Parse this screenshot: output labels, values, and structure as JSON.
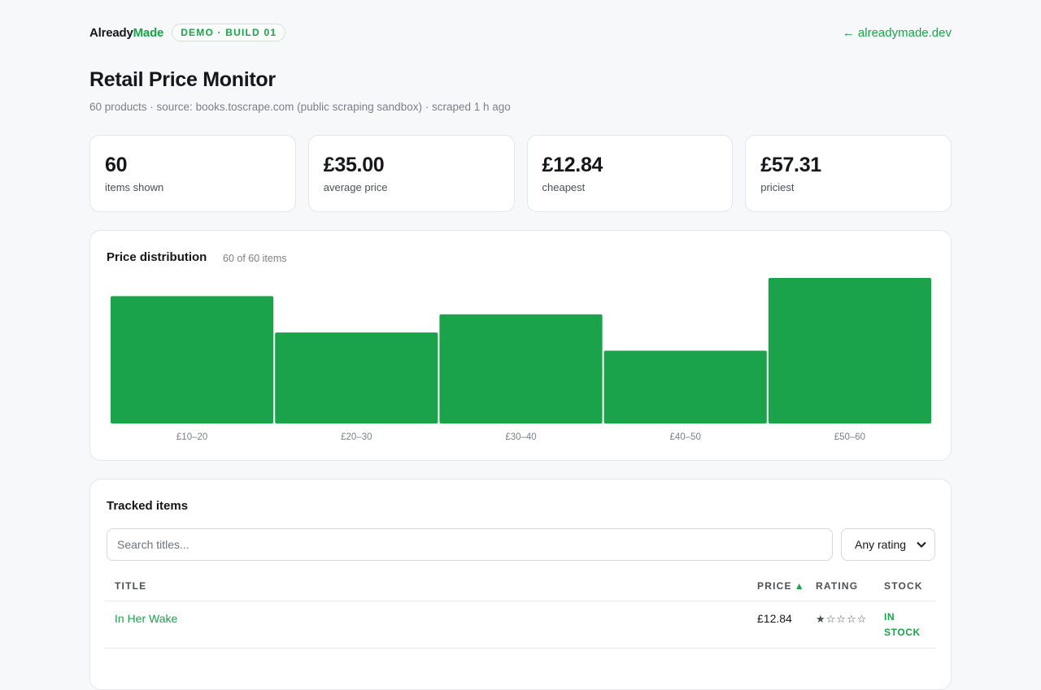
{
  "brand": {
    "name_part1": "Already",
    "name_part2": "Made",
    "badge": "DEMO · BUILD 01",
    "back_link": "← alreadymade.dev"
  },
  "page": {
    "title": "Retail Price Monitor",
    "subtitle": "60 products · source: books.toscrape.com (public scraping sandbox) · scraped 1 h ago"
  },
  "stats": [
    {
      "value": "60",
      "label": "items shown"
    },
    {
      "value": "£35.00",
      "label": "average price"
    },
    {
      "value": "£12.84",
      "label": "cheapest"
    },
    {
      "value": "£57.31",
      "label": "priciest"
    }
  ],
  "chart": {
    "title": "Price distribution",
    "count_label": "60 of 60 items"
  },
  "chart_data": {
    "type": "bar",
    "categories": [
      "£10–20",
      "£20–30",
      "£30–40",
      "£40–50",
      "£50–60"
    ],
    "values": [
      14,
      10,
      12,
      8,
      16
    ],
    "ylim": [
      0,
      16
    ],
    "grid": false,
    "color": "#1aa34a"
  },
  "table": {
    "title": "Tracked items",
    "search_placeholder": "Search titles...",
    "rating_filter": "Any rating",
    "headers": {
      "title": "TITLE",
      "price": "PRICE",
      "price_sort": "▲",
      "rating": "RATING",
      "stock": "STOCK"
    },
    "rows": [
      {
        "title": "In Her Wake",
        "price": "£12.84",
        "rating": "★☆☆☆☆",
        "stock": "IN STOCK"
      }
    ]
  },
  "colors": {
    "accent": "#1aa34a",
    "background": "#f7f8fa",
    "text": "#15171a"
  }
}
